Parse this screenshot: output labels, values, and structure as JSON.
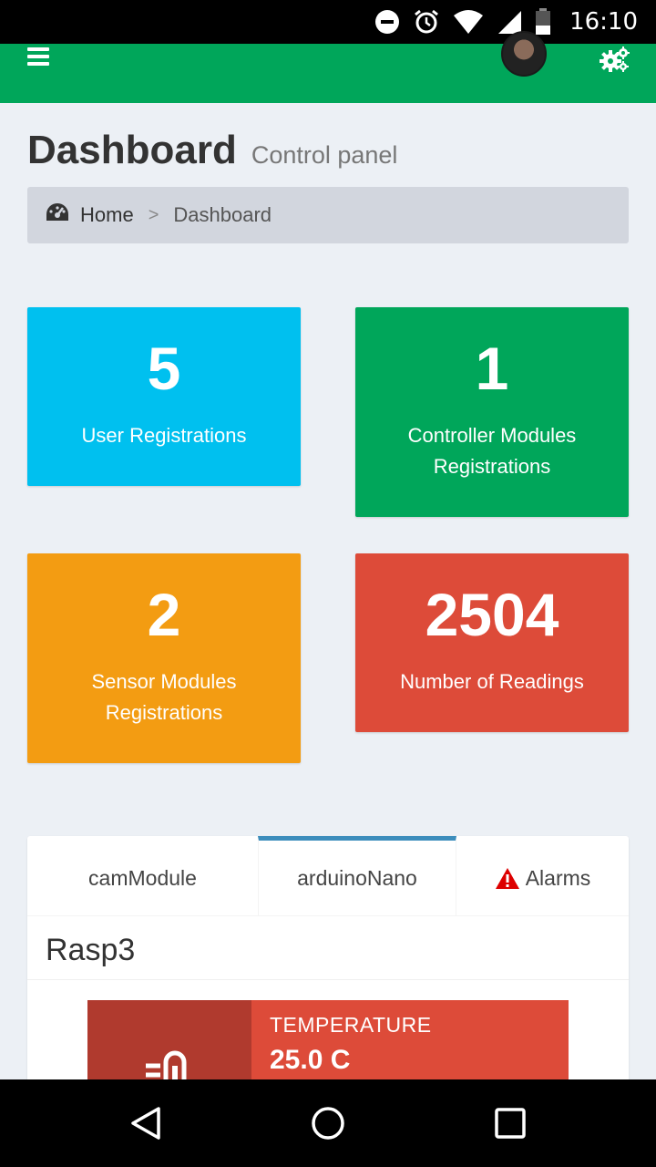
{
  "status_bar": {
    "time": "16:10",
    "icons": [
      "do-not-disturb-icon",
      "alarm-icon",
      "wifi-icon",
      "signal-icon",
      "battery-icon"
    ]
  },
  "header": {
    "menu_icon": "hamburger-icon",
    "settings_icon": "gears-icon",
    "accent_color": "#00a65a"
  },
  "page": {
    "title": "Dashboard",
    "subtitle": "Control panel"
  },
  "breadcrumb": {
    "home": "Home",
    "separator": ">",
    "current": "Dashboard"
  },
  "stats": {
    "users": {
      "value": "5",
      "label": "User Registrations",
      "color": "#00c0ef"
    },
    "controllers": {
      "value": "1",
      "label": "Controller Modules Registrations",
      "color": "#00a65a"
    },
    "sensors": {
      "value": "2",
      "label": "Sensor Modules Registrations",
      "color": "#f39c12"
    },
    "readings": {
      "value": "2504",
      "label": "Number of Readings",
      "color": "#dd4b39"
    }
  },
  "tabs": [
    {
      "label": "camModule"
    },
    {
      "label": "arduinoNano",
      "active": true
    },
    {
      "label": "Alarms",
      "icon": "warning-icon"
    }
  ],
  "device": {
    "title": "Rasp3",
    "infobox": {
      "label": "TEMPERATURE",
      "value": "25.0 C",
      "icon": "thermometer-icon",
      "color": "#dd4b39"
    }
  },
  "nav": {
    "back_icon": "back-triangle-icon",
    "home_icon": "home-circle-icon",
    "recents_icon": "recents-square-icon"
  }
}
